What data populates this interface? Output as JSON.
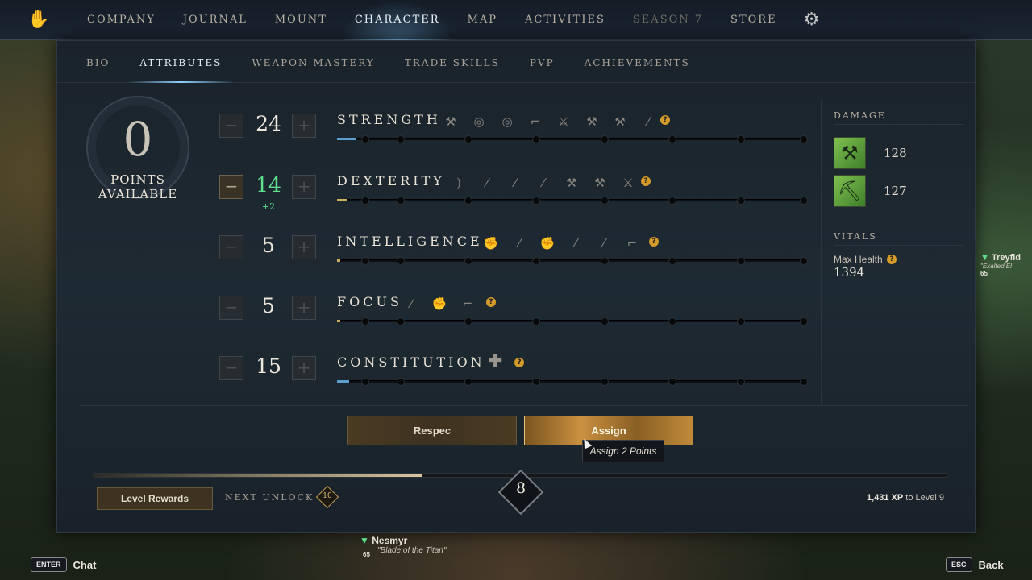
{
  "topnav": {
    "items": [
      "COMPANY",
      "JOURNAL",
      "MOUNT",
      "CHARACTER",
      "MAP",
      "ACTIVITIES",
      "SEASON 7",
      "STORE"
    ],
    "active": "CHARACTER"
  },
  "subnav": {
    "items": [
      "BIO",
      "ATTRIBUTES",
      "WEAPON MASTERY",
      "TRADE SKILLS",
      "PVP",
      "ACHIEVEMENTS"
    ],
    "active": "ATTRIBUTES"
  },
  "points": {
    "value": "0",
    "label_line1": "POINTS",
    "label_line2": "AVAILABLE"
  },
  "attributes": [
    {
      "name": "STRENGTH",
      "value": "24",
      "bonus": "",
      "fill_fraction": 0.04
    },
    {
      "name": "DEXTERITY",
      "value": "14",
      "bonus": "+2",
      "fill_fraction": 0.02
    },
    {
      "name": "INTELLIGENCE",
      "value": "5",
      "bonus": "",
      "fill_fraction": 0.005
    },
    {
      "name": "FOCUS",
      "value": "5",
      "bonus": "",
      "fill_fraction": 0.005
    },
    {
      "name": "CONSTITUTION",
      "value": "15",
      "bonus": "",
      "fill_fraction": 0.025
    }
  ],
  "damage": {
    "heading": "DAMAGE",
    "primary": "128",
    "secondary": "127"
  },
  "vitals": {
    "heading": "VITALS",
    "label": "Max Health",
    "value": "1394"
  },
  "actions": {
    "respec": "Respec",
    "assign": "Assign",
    "tooltip": "Assign 2 Points"
  },
  "level": {
    "rewards_label": "Level Rewards",
    "next_unlock_label": "NEXT UNLOCK",
    "next_unlock_value": "10",
    "current": "8",
    "progress_fraction": 0.385,
    "xp_value": "1,431 XP",
    "xp_suffix": " to Level 9"
  },
  "hud": {
    "chat_key": "ENTER",
    "chat_label": "Chat",
    "back_key": "ESC",
    "back_label": "Back",
    "player_name": "Nesmyr",
    "player_title": "\"Blade of the Titan\"",
    "player_level": "65",
    "other_name": "Treyfid",
    "other_title": "\"Exalted El",
    "other_level": "65"
  },
  "colors": {
    "accent_blue": "#8fd0ff",
    "bonus_green": "#5de08c",
    "help_orange": "#d49a2a",
    "gold": "#c99040"
  }
}
